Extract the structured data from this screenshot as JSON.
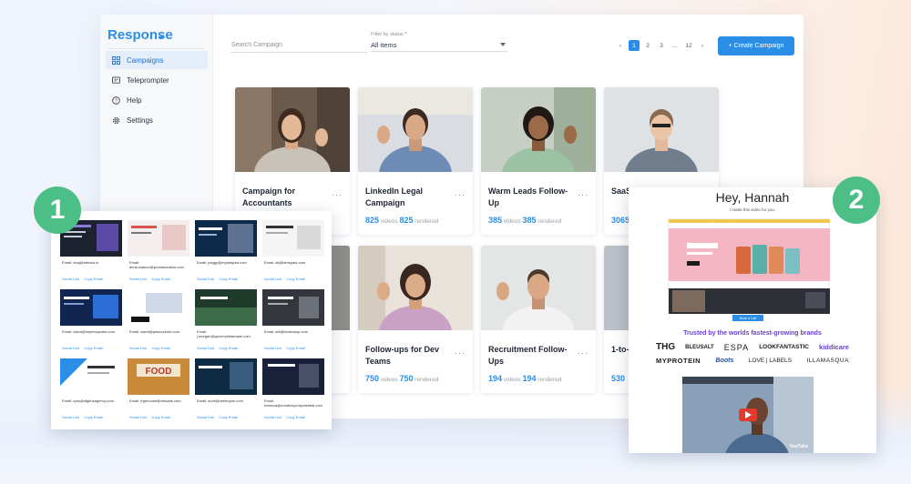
{
  "app": {
    "logo": "Response",
    "nav": [
      {
        "label": "Campaigns",
        "icon": "grid-icon",
        "active": true
      },
      {
        "label": "Teleprompter",
        "icon": "teleprompter-icon",
        "active": false
      },
      {
        "label": "Help",
        "icon": "help-icon",
        "active": false
      },
      {
        "label": "Settings",
        "icon": "gear-icon",
        "active": false
      }
    ],
    "search_placeholder": "Search Campaign",
    "filter": {
      "label": "Filter by status *",
      "value": "All items"
    },
    "pagination": {
      "prev": "‹",
      "pages": [
        "1",
        "2",
        "3",
        "...",
        "12"
      ],
      "current": "1",
      "next": "›"
    },
    "create_button": "+ Create Campaign",
    "cards": [
      {
        "title": "Campaign for Accountants",
        "videos": "",
        "rendered": "",
        "videos_label": "",
        "rendered_label": "rendered"
      },
      {
        "title": "LinkedIn Legal Campaign",
        "videos": "825",
        "rendered": "825",
        "videos_label": "videos",
        "rendered_label": "rendered"
      },
      {
        "title": "Warm Leads Follow-Up",
        "videos": "385",
        "rendered": "385",
        "videos_label": "videos",
        "rendered_label": "rendered"
      },
      {
        "title": "SaaS (Aug",
        "videos": "3065",
        "rendered": "",
        "videos_label": "",
        "rendered_label": ""
      },
      {
        "title": "Follow-ups for Dev Teams",
        "videos": "750",
        "rendered": "750",
        "videos_label": "videos",
        "rendered_label": "rendered"
      },
      {
        "title": "Recruitment Follow-Ups",
        "videos": "194",
        "rendered": "194",
        "videos_label": "videos",
        "rendered_label": "rendered"
      },
      {
        "title": "1-to- Cam",
        "videos": "530",
        "rendered": "",
        "videos_label": "",
        "rendered_label": ""
      }
    ],
    "more_glyph": "···"
  },
  "panel1": {
    "badge": "1",
    "link_social": "Social Link",
    "link_copy": "Copy Email",
    "items": [
      {
        "email": "Email: viraj@artesta.io"
      },
      {
        "email": "Email: anna.watson@proadcreation.com"
      },
      {
        "email": "Email: peggy@mytampart.com"
      },
      {
        "email": "Email: ali@bimspark.com"
      },
      {
        "email": "Email: david@impetusposts.com"
      },
      {
        "email": "Email: david@peacockmb.com"
      },
      {
        "email": "Email: j.morgan@grocerylietamase.com"
      },
      {
        "email": "Email: sid@bimkcloup.com"
      },
      {
        "email": "Email: ryan@digitusagency.com"
      },
      {
        "email": "Email: frgenouse@vetsads.com"
      },
      {
        "email": "Email: scott@centmpire.com"
      },
      {
        "email": "Email: rebecca@creativeyourpotential.com"
      }
    ]
  },
  "panel2": {
    "badge": "2",
    "greeting": "Hey, Hannah",
    "subtitle": "I made this video for you.",
    "site_headline": "Collagen + Adaptogens",
    "book_button": "Book a Call",
    "trusted": "Trusted by the worlds fastest-growing brands",
    "brands_row1": [
      "THG",
      "BLEUSALT",
      "ESPA",
      "LOOKFANTASTIC",
      "kiddicare"
    ],
    "brands_row2": [
      "MYPROTEIN",
      "Boots",
      "LOVE | LABELS",
      "ILLAMASQUA"
    ],
    "video_label": "YouTube",
    "colors": {
      "accent": "#2a8ee6",
      "badge": "#4bbf86",
      "trusted": "#6b3fd6"
    }
  }
}
